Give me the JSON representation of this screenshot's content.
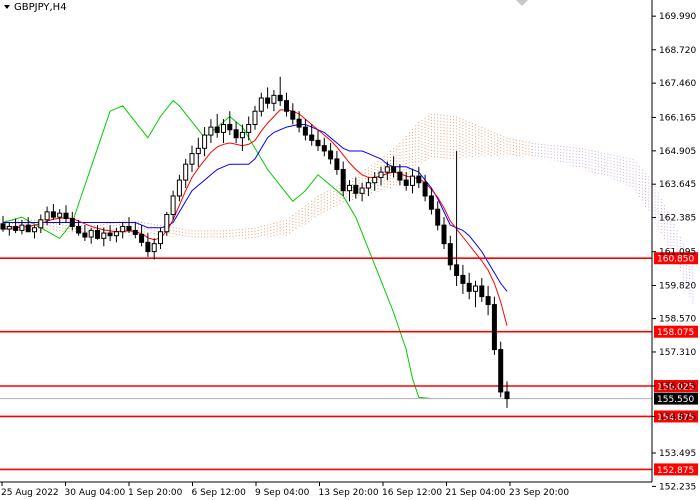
{
  "chart_data": {
    "type": "candlestick",
    "title": "GBPJPY,H4",
    "ylim": [
      152.4,
      170.6
    ],
    "y_ticks": [
      "169.990",
      "168.720",
      "167.460",
      "166.165",
      "164.905",
      "163.645",
      "162.385",
      "161.095",
      "159.820",
      "158.570",
      "157.310",
      "156.025",
      "154.875",
      "153.495",
      "152.235"
    ],
    "x_ticks": [
      "25 Aug 2022",
      "30 Aug 04:00",
      "1 Sep 20:00",
      "6 Sep 12:00",
      "9 Sep 04:00",
      "13 Sep 20:00",
      "16 Sep 12:00",
      "21 Sep 04:00",
      "23 Sep 20:00"
    ],
    "horizontal_levels": [
      {
        "value": 160.85,
        "label": "160.850"
      },
      {
        "value": 158.075,
        "label": "158.075"
      },
      {
        "value": 156.025,
        "label": "156.025"
      },
      {
        "value": 154.875,
        "label": "154.875"
      },
      {
        "value": 152.875,
        "label": "152.875"
      }
    ],
    "current_price": {
      "value": 155.55,
      "label": "155.550"
    },
    "candles": [
      [
        162.15,
        162.45,
        161.85,
        161.95
      ],
      [
        161.95,
        162.2,
        161.7,
        162.05
      ],
      [
        162.05,
        162.35,
        161.8,
        161.9
      ],
      [
        161.9,
        162.3,
        161.75,
        162.1
      ],
      [
        162.1,
        162.4,
        161.9,
        161.85
      ],
      [
        161.85,
        162.1,
        161.6,
        162.0
      ],
      [
        162.0,
        162.5,
        161.8,
        162.3
      ],
      [
        162.3,
        162.8,
        162.1,
        162.6
      ],
      [
        162.6,
        162.9,
        162.3,
        162.4
      ],
      [
        162.4,
        162.7,
        162.1,
        162.55
      ],
      [
        162.55,
        162.85,
        162.2,
        162.35
      ],
      [
        162.35,
        162.6,
        161.9,
        162.05
      ],
      [
        162.05,
        162.3,
        161.7,
        161.8
      ],
      [
        161.8,
        162.1,
        161.5,
        161.65
      ],
      [
        161.65,
        162.0,
        161.4,
        161.9
      ],
      [
        161.9,
        162.1,
        161.55,
        161.6
      ],
      [
        161.6,
        162.0,
        161.3,
        161.8
      ],
      [
        161.8,
        162.1,
        161.5,
        161.7
      ],
      [
        161.7,
        162.0,
        161.45,
        161.85
      ],
      [
        161.85,
        162.2,
        161.6,
        162.05
      ],
      [
        162.05,
        162.4,
        161.8,
        161.9
      ],
      [
        161.9,
        162.2,
        161.6,
        161.75
      ],
      [
        161.75,
        162.1,
        161.3,
        161.45
      ],
      [
        161.45,
        161.8,
        160.9,
        161.1
      ],
      [
        161.1,
        161.6,
        160.8,
        161.4
      ],
      [
        161.4,
        162.0,
        161.2,
        161.85
      ],
      [
        161.85,
        162.6,
        161.7,
        162.5
      ],
      [
        162.5,
        163.4,
        162.3,
        163.2
      ],
      [
        163.2,
        164.0,
        163.0,
        163.8
      ],
      [
        163.8,
        164.6,
        163.5,
        164.4
      ],
      [
        164.4,
        165.1,
        164.1,
        164.8
      ],
      [
        164.8,
        165.4,
        164.3,
        165.0
      ],
      [
        165.0,
        165.8,
        164.7,
        165.5
      ],
      [
        165.5,
        166.1,
        165.2,
        165.8
      ],
      [
        165.8,
        166.3,
        165.4,
        165.6
      ],
      [
        165.6,
        166.1,
        165.2,
        165.9
      ],
      [
        165.9,
        166.4,
        165.5,
        165.7
      ],
      [
        165.7,
        166.0,
        165.2,
        165.4
      ],
      [
        165.4,
        165.9,
        164.9,
        165.6
      ],
      [
        165.6,
        166.2,
        165.3,
        165.9
      ],
      [
        165.9,
        166.6,
        165.7,
        166.4
      ],
      [
        166.4,
        167.1,
        166.2,
        166.9
      ],
      [
        166.9,
        167.3,
        166.5,
        166.7
      ],
      [
        166.7,
        167.2,
        166.4,
        167.0
      ],
      [
        167.0,
        167.7,
        166.6,
        166.8
      ],
      [
        166.8,
        167.1,
        166.2,
        166.4
      ],
      [
        166.4,
        166.7,
        165.9,
        166.1
      ],
      [
        166.1,
        166.4,
        165.6,
        165.8
      ],
      [
        165.8,
        166.1,
        165.3,
        165.5
      ],
      [
        165.5,
        165.9,
        165.1,
        165.3
      ],
      [
        165.3,
        165.7,
        164.9,
        165.1
      ],
      [
        165.1,
        165.4,
        164.7,
        164.9
      ],
      [
        164.9,
        165.2,
        164.4,
        164.6
      ],
      [
        164.6,
        164.9,
        164.0,
        164.2
      ],
      [
        164.2,
        164.5,
        163.2,
        163.4
      ],
      [
        163.4,
        163.8,
        163.0,
        163.6
      ],
      [
        163.6,
        163.9,
        163.1,
        163.3
      ],
      [
        163.3,
        163.7,
        163.0,
        163.5
      ],
      [
        163.5,
        163.9,
        163.2,
        163.7
      ],
      [
        163.7,
        164.1,
        163.4,
        163.9
      ],
      [
        163.9,
        164.3,
        163.6,
        164.1
      ],
      [
        164.1,
        164.5,
        163.8,
        164.3
      ],
      [
        164.3,
        164.7,
        163.9,
        164.1
      ],
      [
        164.1,
        164.4,
        163.6,
        163.8
      ],
      [
        163.8,
        164.1,
        163.4,
        163.6
      ],
      [
        163.6,
        164.2,
        163.3,
        163.95
      ],
      [
        163.95,
        164.3,
        163.5,
        163.7
      ],
      [
        163.7,
        164.0,
        163.0,
        163.2
      ],
      [
        163.2,
        163.5,
        162.5,
        162.7
      ],
      [
        162.7,
        163.0,
        161.9,
        162.1
      ],
      [
        162.1,
        162.4,
        161.2,
        161.4
      ],
      [
        161.4,
        161.7,
        160.4,
        160.6
      ],
      [
        160.6,
        164.9,
        159.8,
        160.2
      ],
      [
        160.2,
        160.6,
        159.5,
        159.9
      ],
      [
        159.9,
        160.3,
        159.3,
        159.6
      ],
      [
        159.6,
        160.0,
        159.0,
        159.8
      ],
      [
        159.8,
        160.1,
        159.2,
        159.4
      ],
      [
        159.4,
        159.8,
        158.7,
        159.1
      ],
      [
        159.1,
        159.4,
        157.2,
        157.4
      ],
      [
        157.4,
        157.7,
        155.6,
        155.8
      ],
      [
        155.8,
        156.2,
        155.2,
        155.55
      ]
    ],
    "red_line": [
      161.95,
      161.98,
      162.0,
      162.02,
      162.05,
      162.1,
      162.15,
      162.25,
      162.32,
      162.36,
      162.38,
      162.35,
      162.25,
      162.15,
      162.05,
      161.98,
      161.92,
      161.88,
      161.85,
      161.86,
      161.88,
      161.85,
      161.78,
      161.62,
      161.55,
      161.62,
      161.88,
      162.3,
      162.85,
      163.4,
      163.9,
      164.25,
      164.55,
      164.85,
      165.05,
      165.15,
      165.2,
      165.15,
      165.1,
      165.15,
      165.3,
      165.65,
      165.95,
      166.2,
      166.45,
      166.45,
      166.4,
      166.3,
      166.1,
      165.9,
      165.7,
      165.5,
      165.3,
      165.05,
      164.75,
      164.45,
      164.2,
      164.0,
      163.9,
      163.9,
      163.95,
      164.05,
      164.1,
      164.05,
      163.95,
      163.9,
      163.85,
      163.7,
      163.45,
      163.15,
      162.75,
      162.25,
      161.95,
      161.65,
      161.35,
      161.05,
      160.75,
      160.4,
      159.9,
      159.2,
      158.3
    ],
    "blue_line": [
      162.2,
      162.2,
      162.2,
      162.2,
      162.2,
      162.2,
      162.2,
      162.2,
      162.2,
      162.2,
      162.2,
      162.2,
      162.2,
      162.2,
      162.2,
      162.2,
      162.2,
      162.2,
      162.2,
      162.2,
      162.2,
      162.2,
      162.1,
      162.0,
      162.0,
      162.0,
      162.05,
      162.2,
      162.6,
      163.0,
      163.4,
      163.6,
      163.8,
      164.0,
      164.2,
      164.3,
      164.4,
      164.4,
      164.4,
      164.4,
      164.6,
      165.0,
      165.4,
      165.6,
      165.7,
      165.8,
      165.85,
      165.9,
      165.9,
      165.8,
      165.7,
      165.6,
      165.4,
      165.2,
      165.0,
      164.9,
      164.9,
      164.9,
      164.8,
      164.7,
      164.6,
      164.4,
      164.3,
      164.3,
      164.3,
      164.2,
      164.1,
      163.8,
      163.5,
      163.1,
      162.6,
      162.1,
      162.0,
      161.9,
      161.7,
      161.4,
      161.1,
      160.7,
      160.3,
      159.9,
      159.6
    ],
    "green_line": [
      [
        0,
        162.2
      ],
      [
        3,
        162.4
      ],
      [
        6,
        162.0
      ],
      [
        9,
        161.6
      ],
      [
        11,
        162.2
      ],
      [
        13,
        163.6
      ],
      [
        15,
        165.0
      ],
      [
        17,
        166.4
      ],
      [
        19,
        166.6
      ],
      [
        21,
        166.0
      ],
      [
        23,
        165.4
      ],
      [
        25,
        166.2
      ],
      [
        27,
        166.8
      ],
      [
        28,
        166.6
      ],
      [
        30,
        166.0
      ],
      [
        32,
        165.4
      ],
      [
        34,
        165.8
      ],
      [
        36,
        166.2
      ],
      [
        38,
        165.8
      ],
      [
        40,
        165.0
      ],
      [
        42,
        164.2
      ],
      [
        44,
        163.6
      ],
      [
        46,
        163.0
      ],
      [
        48,
        163.4
      ],
      [
        50,
        164.0
      ],
      [
        52,
        163.6
      ],
      [
        54,
        163.2
      ],
      [
        56,
        162.4
      ],
      [
        58,
        161.2
      ],
      [
        60,
        160.0
      ],
      [
        62,
        158.8
      ],
      [
        64,
        157.4
      ],
      [
        65,
        156.3
      ],
      [
        66,
        155.6
      ],
      [
        68,
        155.55
      ]
    ],
    "cloud_band": [
      [
        0,
        162.3,
        161.9
      ],
      [
        5,
        162.3,
        161.9
      ],
      [
        10,
        162.1,
        161.8
      ],
      [
        15,
        162.1,
        161.8
      ],
      [
        20,
        162.3,
        161.7
      ],
      [
        25,
        162.1,
        161.7
      ],
      [
        30,
        161.9,
        161.6
      ],
      [
        35,
        161.9,
        161.6
      ],
      [
        40,
        162.0,
        161.6
      ],
      [
        45,
        162.3,
        161.7
      ],
      [
        50,
        163.2,
        162.4
      ],
      [
        55,
        163.8,
        163.0
      ],
      [
        60,
        164.6,
        163.4
      ],
      [
        63,
        165.2,
        163.6
      ],
      [
        66,
        166.0,
        164.4
      ],
      [
        68,
        166.3,
        164.6
      ],
      [
        72,
        166.2,
        164.6
      ],
      [
        76,
        165.8,
        164.7
      ],
      [
        80,
        165.4,
        164.7
      ],
      [
        84,
        165.2,
        164.7
      ],
      [
        88,
        165.1,
        164.5
      ],
      [
        92,
        165.0,
        164.2
      ],
      [
        96,
        164.8,
        163.9
      ],
      [
        100,
        164.6,
        163.5
      ],
      [
        103,
        163.8,
        162.4
      ],
      [
        107,
        161.9,
        160.6
      ],
      [
        110,
        160.4,
        158.8
      ]
    ],
    "cloud_colors": {
      "bear": "#e8a070",
      "bull": "#c8b0e0"
    },
    "colors": {
      "candle": "#000000",
      "red_line": "#ff0000",
      "blue_line": "#0000ff",
      "green_line": "#00cc00",
      "level": "#ff0000",
      "level_label_bg": "#ff0000",
      "price_label_bg": "#000000"
    }
  }
}
